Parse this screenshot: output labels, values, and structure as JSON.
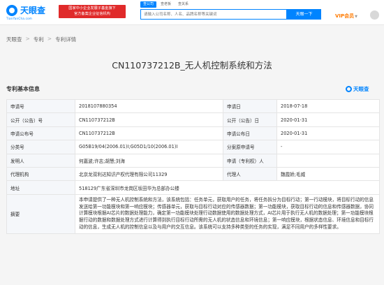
{
  "header": {
    "logo_text": "天眼查",
    "logo_sub": "TianYanCha.com",
    "promo_line1": "国家中小企业发展子基金旗下",
    "promo_line2": "官方备案企业征信机构",
    "search_tabs": [
      "查公司",
      "查老板",
      "查关系"
    ],
    "search_placeholder": "请输入公司名称、人名、品牌名称等关键词",
    "search_button": "天眼一下",
    "vip_label": "VIP会员"
  },
  "breadcrumb": [
    "天眼查",
    "专利",
    "专利详情"
  ],
  "page_title": "CN110737212B_无人机控制系统和方法",
  "section": {
    "title": "专利基本信息",
    "brand": "天眼查"
  },
  "table": {
    "rows": [
      {
        "l1": "申请号",
        "v1": "2018107880354",
        "l2": "申请日",
        "v2": "2018-07-18"
      },
      {
        "l1": "公开（公告）号",
        "v1": "CN110737212B",
        "l2": "公开（公告）日",
        "v2": "2020-01-31"
      },
      {
        "l1": "申请公布号",
        "v1": "CN110737212B",
        "l2": "申请公布日",
        "v2": "2020-01-31"
      },
      {
        "l1": "分类号",
        "v1": "G05B19/04(2006.01)I;G05D1/10(2006.01)I",
        "l2": "分案原申请号",
        "v2": "-"
      },
      {
        "l1": "发明人",
        "v1": "何嘉波;许志;胡慧;刘海",
        "l2": "申请（专利权）人",
        "v2": ""
      },
      {
        "l1": "代理机构",
        "v1": "北京龙双利达知识产权代理有限公司11329",
        "l2": "代理人",
        "v2": "魏霞娇;毛威"
      }
    ],
    "address_label": "地址",
    "address_value": "518129广东省深圳市龙岗区坂田华为总部办公楼",
    "abstract_label": "摘要",
    "abstract_value": "本申请提供了一种无人机控制系统和方法，该系统包括：任务单元，获取用户的任务，将任务拆分为目标行动；第一行动模块，将目标行动的信息发送给第一功能模块和第一响应模块；传感器单元，获取与目标行动对应的传感器数据；第一功能模块，获取目标行动的信息和传感器数据，协同计算模块根据AI芯片的数据处理能力，确定第一功能模块处理行动数据使用的数据处理方式，AI芯片用于执行无人机的数据处理；第一功能模块根据行动的数据和数据处理方式进行计算得到执行目标行动所需的无人机的状态信息和环境信息；第一响应模块，根据状态信息、环境信息和目标行动的信息，生成无人机的控制信息以及与用户的交互信息。该系统可以支持多种类型的任务的实现，满足不同用户的多样性要求。"
  }
}
